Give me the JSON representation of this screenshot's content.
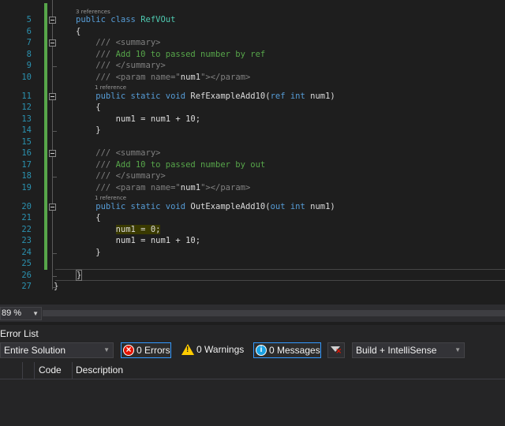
{
  "code_lines": [
    {
      "num": "5",
      "codelens": "3 references",
      "tokens": [
        {
          "t": "public class ",
          "c": "kw"
        },
        {
          "t": "RefVOut",
          "c": "ty"
        }
      ]
    },
    {
      "num": "6",
      "tokens": [
        {
          "t": "{",
          "c": ""
        }
      ]
    },
    {
      "num": "7",
      "tokens": [
        {
          "t": "    /// ",
          "c": "tg"
        },
        {
          "t": "<summary>",
          "c": "tg"
        }
      ]
    },
    {
      "num": "8",
      "tokens": [
        {
          "t": "    /// ",
          "c": "tg"
        },
        {
          "t": "Add 10 to passed number by ref",
          "c": "cm"
        }
      ]
    },
    {
      "num": "9",
      "tokens": [
        {
          "t": "    /// ",
          "c": "tg"
        },
        {
          "t": "</summary>",
          "c": "tg"
        }
      ]
    },
    {
      "num": "10",
      "tokens": [
        {
          "t": "    /// ",
          "c": "tg"
        },
        {
          "t": "<param name=\"",
          "c": "tg"
        },
        {
          "t": "num1",
          "c": ""
        },
        {
          "t": "\"></param>",
          "c": "tg"
        }
      ]
    },
    {
      "num": "11",
      "codelens": "1 reference",
      "tokens": [
        {
          "t": "    public static void ",
          "c": "kw"
        },
        {
          "t": "RefExampleAdd10(",
          "c": ""
        },
        {
          "t": "ref int ",
          "c": "kw"
        },
        {
          "t": "num1)",
          "c": ""
        }
      ]
    },
    {
      "num": "12",
      "tokens": [
        {
          "t": "    {",
          "c": ""
        }
      ]
    },
    {
      "num": "13",
      "tokens": [
        {
          "t": "        num1 = num1 + 10;",
          "c": ""
        }
      ]
    },
    {
      "num": "14",
      "tokens": [
        {
          "t": "    }",
          "c": ""
        }
      ]
    },
    {
      "num": "15",
      "tokens": []
    },
    {
      "num": "16",
      "tokens": [
        {
          "t": "    /// ",
          "c": "tg"
        },
        {
          "t": "<summary>",
          "c": "tg"
        }
      ]
    },
    {
      "num": "17",
      "tokens": [
        {
          "t": "    /// ",
          "c": "tg"
        },
        {
          "t": "Add 10 to passed number by out",
          "c": "cm"
        }
      ]
    },
    {
      "num": "18",
      "tokens": [
        {
          "t": "    /// ",
          "c": "tg"
        },
        {
          "t": "</summary>",
          "c": "tg"
        }
      ]
    },
    {
      "num": "19",
      "tokens": [
        {
          "t": "    /// ",
          "c": "tg"
        },
        {
          "t": "<param name=\"",
          "c": "tg"
        },
        {
          "t": "num1",
          "c": ""
        },
        {
          "t": "\"></param>",
          "c": "tg"
        }
      ]
    },
    {
      "num": "20",
      "codelens": "1 reference",
      "tokens": [
        {
          "t": "    public static void ",
          "c": "kw"
        },
        {
          "t": "OutExampleAdd10(",
          "c": ""
        },
        {
          "t": "out int ",
          "c": "kw"
        },
        {
          "t": "num1)",
          "c": ""
        }
      ]
    },
    {
      "num": "21",
      "tokens": [
        {
          "t": "    {",
          "c": ""
        }
      ]
    },
    {
      "num": "22",
      "tokens": [
        {
          "t": "        ",
          "c": ""
        },
        {
          "t": "num1 = 0;",
          "c": "hl"
        }
      ]
    },
    {
      "num": "23",
      "tokens": [
        {
          "t": "        num1 = num1 + 10;",
          "c": ""
        }
      ]
    },
    {
      "num": "24",
      "tokens": [
        {
          "t": "    }",
          "c": ""
        }
      ]
    },
    {
      "num": "25",
      "tokens": []
    },
    {
      "num": "26",
      "tokens": [
        {
          "t": "}",
          "c": "brace"
        }
      ]
    },
    {
      "num": "27",
      "tokens": [
        {
          "t": "}",
          "c": "outer"
        }
      ]
    }
  ],
  "status": {
    "zoom": "89 %"
  },
  "error_list": {
    "title": "Error List",
    "scope": "Entire Solution",
    "errors": "0 Errors",
    "warnings": "0 Warnings",
    "messages": "0 Messages",
    "build_filter": "Build + IntelliSense",
    "columns": {
      "code": "Code",
      "description": "Description"
    }
  },
  "colors": {
    "editor_bg": "#1e1e1e",
    "keyword": "#569cd6",
    "type": "#4ec9b0",
    "comment": "#57a64a",
    "line_number": "#2b91af",
    "selection_border": "#3399ff"
  }
}
